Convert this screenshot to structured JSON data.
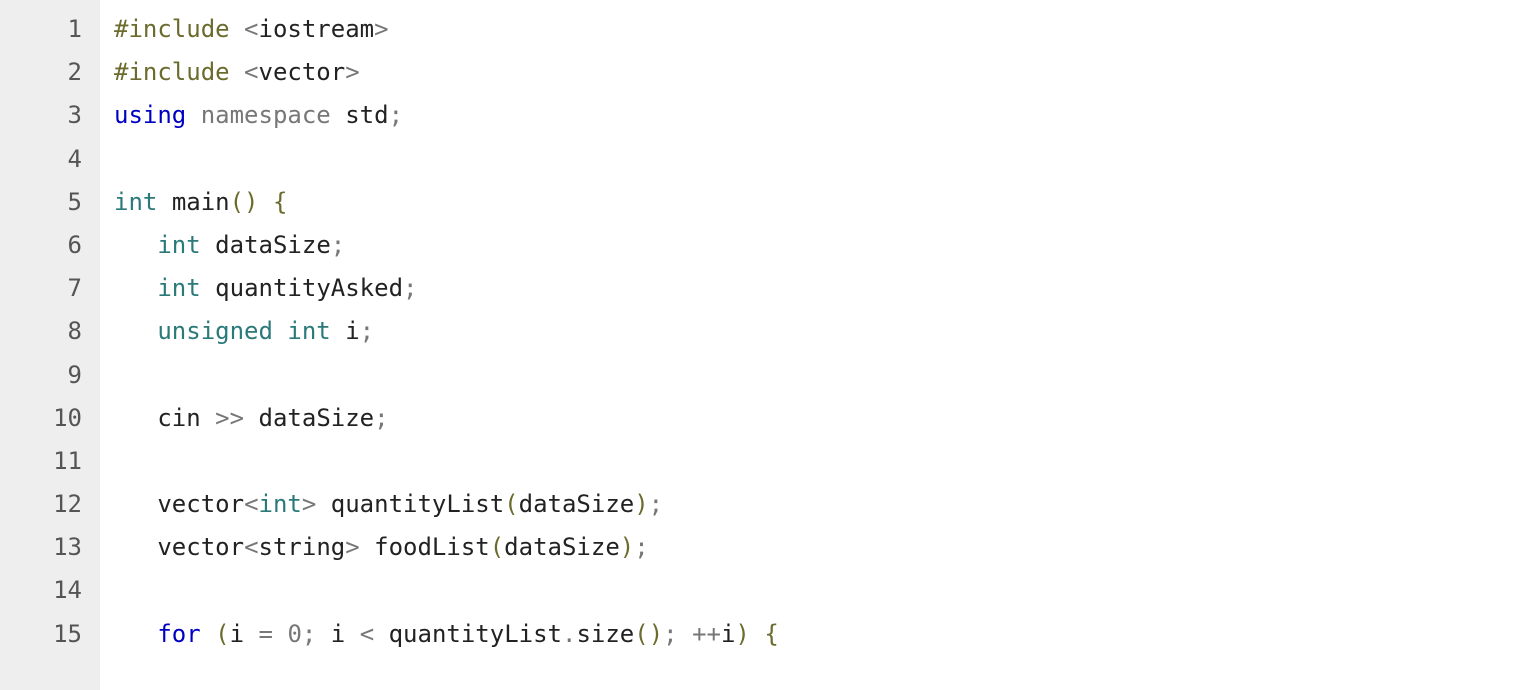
{
  "lines": [
    {
      "num": "1",
      "tokens": [
        [
          "pp",
          "#include"
        ],
        [
          "",
          " "
        ],
        [
          "op",
          "<"
        ],
        [
          "id",
          "iostream"
        ],
        [
          "op",
          ">"
        ]
      ]
    },
    {
      "num": "2",
      "tokens": [
        [
          "pp",
          "#include"
        ],
        [
          "",
          " "
        ],
        [
          "op",
          "<"
        ],
        [
          "id",
          "vector"
        ],
        [
          "op",
          ">"
        ]
      ]
    },
    {
      "num": "3",
      "tokens": [
        [
          "kw",
          "using"
        ],
        [
          "",
          " "
        ],
        [
          "ns",
          "namespace"
        ],
        [
          "",
          " "
        ],
        [
          "id",
          "std"
        ],
        [
          "op",
          ";"
        ]
      ]
    },
    {
      "num": "4",
      "tokens": []
    },
    {
      "num": "5",
      "tokens": [
        [
          "type",
          "int"
        ],
        [
          "",
          " "
        ],
        [
          "fn",
          "main"
        ],
        [
          "paren",
          "()"
        ],
        [
          "",
          " "
        ],
        [
          "paren",
          "{"
        ]
      ]
    },
    {
      "num": "6",
      "tokens": [
        [
          "",
          "   "
        ],
        [
          "type",
          "int"
        ],
        [
          "",
          " "
        ],
        [
          "id",
          "dataSize"
        ],
        [
          "op",
          ";"
        ]
      ]
    },
    {
      "num": "7",
      "tokens": [
        [
          "",
          "   "
        ],
        [
          "type",
          "int"
        ],
        [
          "",
          " "
        ],
        [
          "id",
          "quantityAsked"
        ],
        [
          "op",
          ";"
        ]
      ]
    },
    {
      "num": "8",
      "tokens": [
        [
          "",
          "   "
        ],
        [
          "type",
          "unsigned"
        ],
        [
          "",
          " "
        ],
        [
          "type",
          "int"
        ],
        [
          "",
          " "
        ],
        [
          "id",
          "i"
        ],
        [
          "op",
          ";"
        ]
      ]
    },
    {
      "num": "9",
      "tokens": []
    },
    {
      "num": "10",
      "tokens": [
        [
          "",
          "   "
        ],
        [
          "id",
          "cin"
        ],
        [
          "",
          " "
        ],
        [
          "op",
          ">>"
        ],
        [
          "",
          " "
        ],
        [
          "id",
          "dataSize"
        ],
        [
          "op",
          ";"
        ]
      ]
    },
    {
      "num": "11",
      "tokens": []
    },
    {
      "num": "12",
      "tokens": [
        [
          "",
          "   "
        ],
        [
          "id",
          "vector"
        ],
        [
          "op",
          "<"
        ],
        [
          "type",
          "int"
        ],
        [
          "op",
          ">"
        ],
        [
          "",
          " "
        ],
        [
          "id",
          "quantityList"
        ],
        [
          "paren",
          "("
        ],
        [
          "id",
          "dataSize"
        ],
        [
          "paren",
          ")"
        ],
        [
          "op",
          ";"
        ]
      ]
    },
    {
      "num": "13",
      "tokens": [
        [
          "",
          "   "
        ],
        [
          "id",
          "vector"
        ],
        [
          "op",
          "<"
        ],
        [
          "id",
          "string"
        ],
        [
          "op",
          ">"
        ],
        [
          "",
          " "
        ],
        [
          "id",
          "foodList"
        ],
        [
          "paren",
          "("
        ],
        [
          "id",
          "dataSize"
        ],
        [
          "paren",
          ")"
        ],
        [
          "op",
          ";"
        ]
      ]
    },
    {
      "num": "14",
      "tokens": []
    },
    {
      "num": "15",
      "tokens": [
        [
          "",
          "   "
        ],
        [
          "kw",
          "for"
        ],
        [
          "",
          " "
        ],
        [
          "paren",
          "("
        ],
        [
          "id",
          "i"
        ],
        [
          "",
          " "
        ],
        [
          "op",
          "="
        ],
        [
          "",
          " "
        ],
        [
          "num",
          "0"
        ],
        [
          "op",
          ";"
        ],
        [
          "",
          " "
        ],
        [
          "id",
          "i"
        ],
        [
          "",
          " "
        ],
        [
          "op",
          "<"
        ],
        [
          "",
          " "
        ],
        [
          "id",
          "quantityList"
        ],
        [
          "op",
          "."
        ],
        [
          "id",
          "size"
        ],
        [
          "paren",
          "()"
        ],
        [
          "op",
          ";"
        ],
        [
          "",
          " "
        ],
        [
          "op",
          "++"
        ],
        [
          "id",
          "i"
        ],
        [
          "paren",
          ")"
        ],
        [
          "",
          " "
        ],
        [
          "paren",
          "{"
        ]
      ]
    }
  ]
}
